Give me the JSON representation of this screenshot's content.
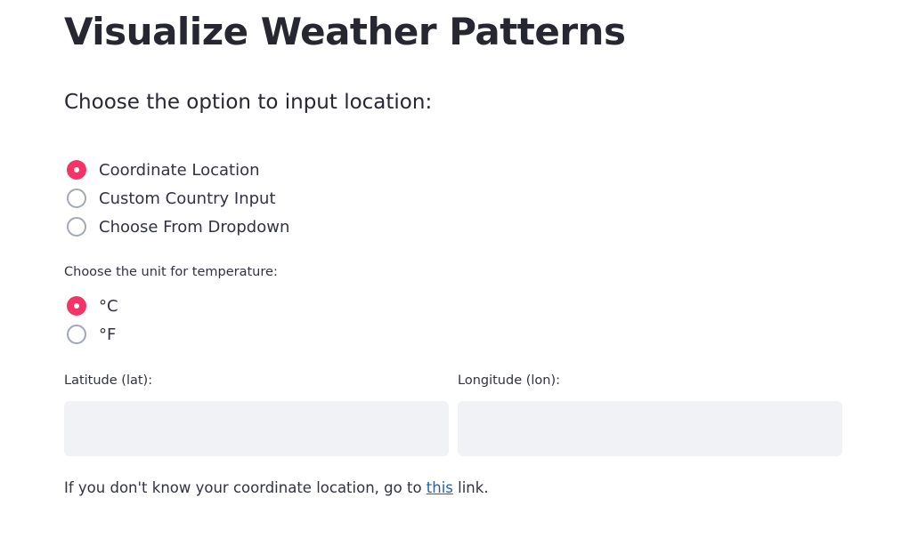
{
  "page": {
    "title": "Visualize Weather Patterns",
    "subtitle": "Choose the option to input location:"
  },
  "location_options": {
    "selected_index": 0,
    "items": [
      {
        "label": "Coordinate Location",
        "checked": true
      },
      {
        "label": "Custom Country Input",
        "checked": false
      },
      {
        "label": "Choose From Dropdown",
        "checked": false
      }
    ]
  },
  "unit_options": {
    "label": "Choose the unit for temperature:",
    "selected_index": 0,
    "items": [
      {
        "label": "°C",
        "checked": true
      },
      {
        "label": "°F",
        "checked": false
      }
    ]
  },
  "latitude": {
    "label": "Latitude (lat):",
    "value": ""
  },
  "longitude": {
    "label": "Longitude (lon):",
    "value": ""
  },
  "help": {
    "prefix": "If you don't know your coordinate location, go to ",
    "link_text": "this",
    "suffix": " link."
  },
  "colors": {
    "accent": "#f63366",
    "link": "#1c62b9",
    "input_bg": "#f0f2f6",
    "radio_border": "#a3a8b8",
    "text": "#31333f"
  }
}
